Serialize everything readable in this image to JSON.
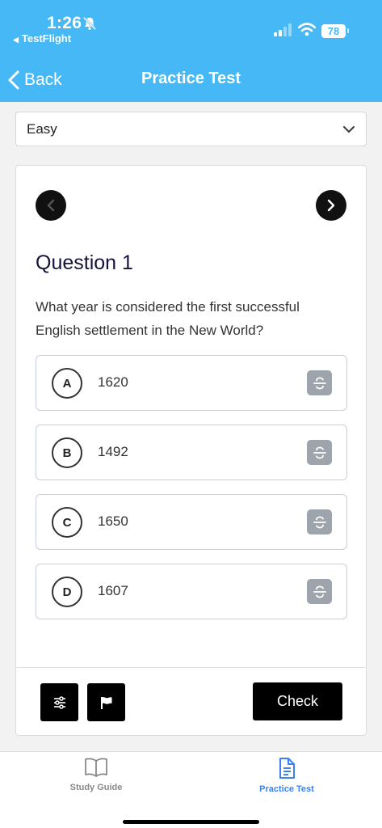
{
  "status": {
    "time": "1:26",
    "back_app": "TestFlight",
    "battery": "78"
  },
  "header": {
    "back_label": "Back",
    "title": "Practice Test"
  },
  "difficulty": {
    "selected": "Easy"
  },
  "question": {
    "heading": "Question 1",
    "text": "What year is considered the first successful English settlement in the New World?",
    "options": [
      {
        "letter": "A",
        "text": "1620"
      },
      {
        "letter": "B",
        "text": "1492"
      },
      {
        "letter": "C",
        "text": "1650"
      },
      {
        "letter": "D",
        "text": "1607"
      }
    ]
  },
  "actions": {
    "check_label": "Check"
  },
  "tabs": [
    {
      "label": "Study Guide",
      "icon": "book-icon",
      "active": false
    },
    {
      "label": "Practice Test",
      "icon": "document-icon",
      "active": true
    }
  ],
  "colors": {
    "header_bg": "#45b8f5",
    "active_tab": "#3b82f6",
    "strike_button": "#9ea4ab"
  }
}
